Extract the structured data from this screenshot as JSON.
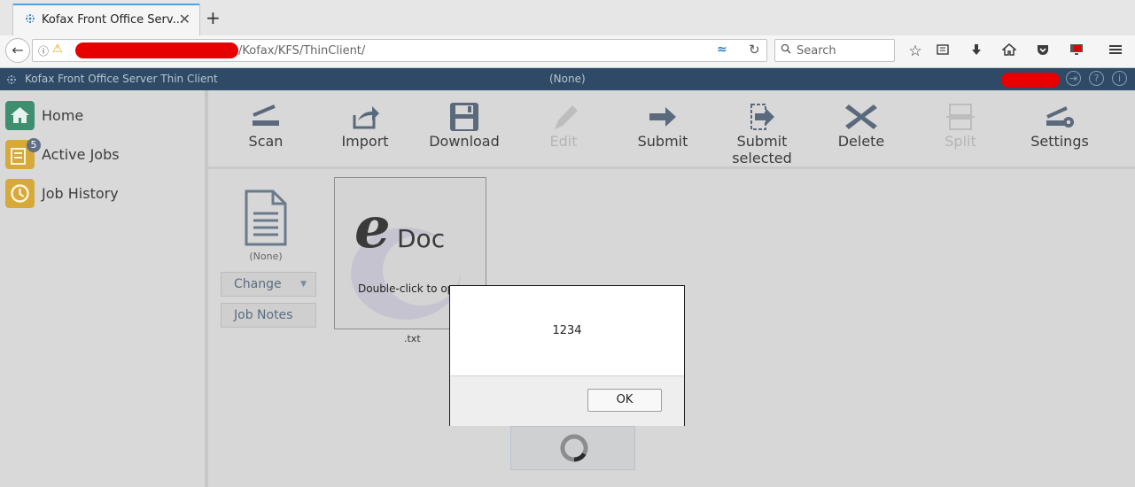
{
  "browser": {
    "tab_title": "Kofax Front Office Serv...",
    "tab_close": "✕",
    "new_tab": "+",
    "url_path": "/Kofax/KFS/ThinClient/",
    "search_placeholder": "Search",
    "back": "←",
    "info": "ⓘ",
    "warn": "⚠",
    "reader": "≈",
    "reload": "↻",
    "toolbar_icons": [
      "star-icon",
      "reading-list-icon",
      "download-icon",
      "home-icon",
      "pocket-icon",
      "screen-icon",
      "menu-icon"
    ]
  },
  "app": {
    "title": "Kofax Front Office Server Thin Client",
    "center_label": "(None)"
  },
  "sidebar": {
    "items": [
      {
        "label": "Home",
        "icon": "home-icon",
        "color": "#3d8f70"
      },
      {
        "label": "Active Jobs",
        "icon": "active-jobs-icon",
        "color": "#d6a93a",
        "badge": "5"
      },
      {
        "label": "Job History",
        "icon": "job-history-icon",
        "color": "#d6a93a"
      }
    ]
  },
  "toolbar": {
    "scan": "Scan",
    "import": "Import",
    "download": "Download",
    "edit": "Edit",
    "submit": "Submit",
    "submit_selected_1": "Submit",
    "submit_selected_2": "selected",
    "delete": "Delete",
    "split": "Split",
    "settings": "Settings"
  },
  "document": {
    "class_label": "(None)",
    "change_button": "Change",
    "job_notes_button": "Job Notes",
    "thumb_logo_e": "e",
    "thumb_logo_doc": "Doc",
    "thumb_caption": "Double-click to open",
    "file_name": ".txt"
  },
  "dialog": {
    "message": "1234",
    "ok": "OK"
  },
  "colors": {
    "app_header": "#2e4a66",
    "accent_blue": "#4aa3e8",
    "redaction": "#e60000"
  }
}
